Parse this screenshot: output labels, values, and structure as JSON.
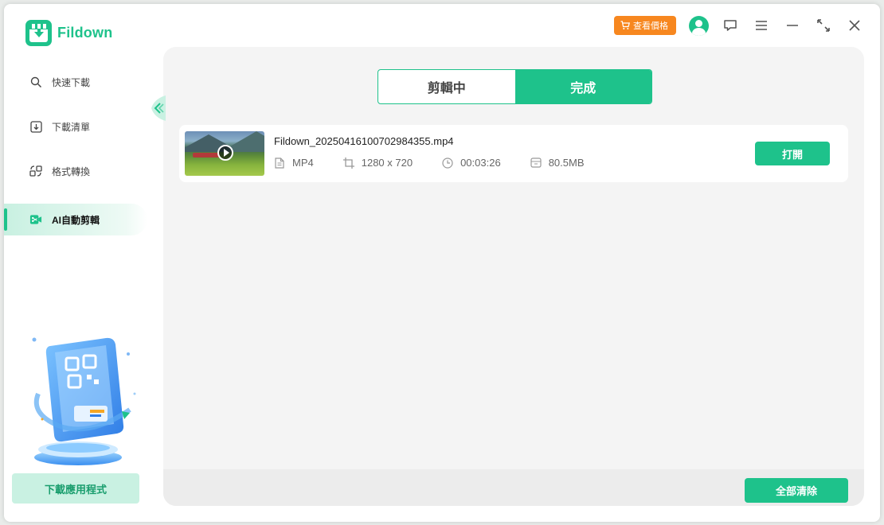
{
  "app": {
    "name": "Fildown"
  },
  "titlebar": {
    "price_label": "查看價格",
    "icons": [
      "cart-icon",
      "user-avatar-icon",
      "feedback-icon",
      "menu-icon",
      "minimize-icon",
      "maximize-icon",
      "close-icon"
    ]
  },
  "sidebar": {
    "items": [
      {
        "label": "快速下載",
        "icon": "search-icon",
        "active": false
      },
      {
        "label": "下載清單",
        "icon": "download-list-icon",
        "active": false
      },
      {
        "label": "格式轉換",
        "icon": "convert-icon",
        "active": false
      },
      {
        "label": "AI自動剪輯",
        "icon": "video-edit-icon",
        "active": true
      }
    ],
    "app_download_label": "下載應用程式"
  },
  "main": {
    "tabs": [
      {
        "label": "剪輯中",
        "active": false
      },
      {
        "label": "完成",
        "active": true
      }
    ],
    "files": [
      {
        "name": "Fildown_20250416100702984355.mp4",
        "format": "MP4",
        "resolution": "1280 x 720",
        "duration": "00:03:26",
        "size": "80.5MB",
        "open_label": "打開"
      }
    ],
    "clear_all_label": "全部清除"
  },
  "colors": {
    "accent": "#1ec28b",
    "price": "#f7871f"
  }
}
